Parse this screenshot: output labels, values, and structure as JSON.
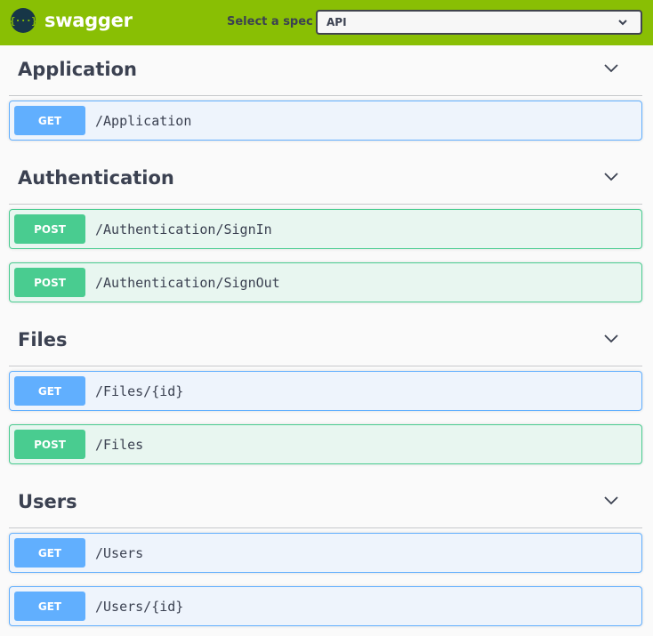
{
  "header": {
    "logo_glyph": "{···}",
    "logo_text": "swagger",
    "spec_label": "Select a spec",
    "spec_selected": "API",
    "brand_color": "#89bf04"
  },
  "sections": [
    {
      "title": "Application",
      "operations": [
        {
          "method": "GET",
          "path": "/Application"
        }
      ]
    },
    {
      "title": "Authentication",
      "operations": [
        {
          "method": "POST",
          "path": "/Authentication/SignIn"
        },
        {
          "method": "POST",
          "path": "/Authentication/SignOut"
        }
      ]
    },
    {
      "title": "Files",
      "operations": [
        {
          "method": "GET",
          "path": "/Files/{id}"
        },
        {
          "method": "POST",
          "path": "/Files"
        }
      ]
    },
    {
      "title": "Users",
      "operations": [
        {
          "method": "GET",
          "path": "/Users"
        },
        {
          "method": "GET",
          "path": "/Users/{id}"
        }
      ]
    }
  ],
  "colors": {
    "get": "#61affe",
    "post": "#49cc90"
  }
}
